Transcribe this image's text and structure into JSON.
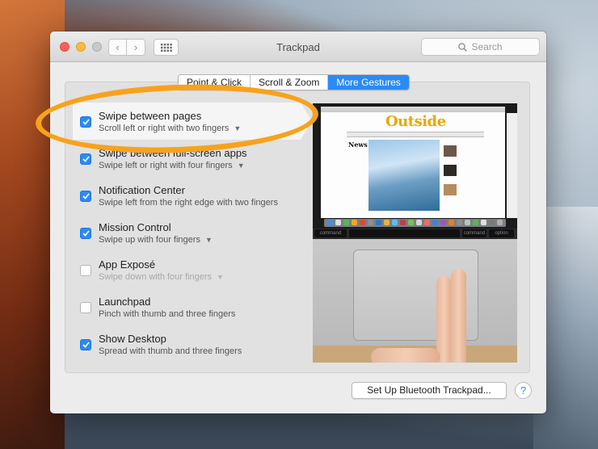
{
  "window": {
    "title": "Trackpad"
  },
  "search": {
    "placeholder": "Search"
  },
  "tabs": [
    {
      "label": "Point & Click",
      "active": false
    },
    {
      "label": "Scroll & Zoom",
      "active": false
    },
    {
      "label": "More Gestures",
      "active": true
    }
  ],
  "gestures": [
    {
      "title": "Swipe between pages",
      "subtitle": "Scroll left or right with two fingers",
      "checked": true,
      "has_dropdown": true,
      "disabled": false,
      "selected": true
    },
    {
      "title": "Swipe between full-screen apps",
      "subtitle": "Swipe left or right with four fingers",
      "checked": true,
      "has_dropdown": true,
      "disabled": false,
      "selected": false
    },
    {
      "title": "Notification Center",
      "subtitle": "Swipe left from the right edge with two fingers",
      "checked": true,
      "has_dropdown": false,
      "disabled": false,
      "selected": false
    },
    {
      "title": "Mission Control",
      "subtitle": "Swipe up with four fingers",
      "checked": true,
      "has_dropdown": true,
      "disabled": false,
      "selected": false
    },
    {
      "title": "App Exposé",
      "subtitle": "Swipe down with four fingers",
      "checked": false,
      "has_dropdown": true,
      "disabled": true,
      "selected": false
    },
    {
      "title": "Launchpad",
      "subtitle": "Pinch with thumb and three fingers",
      "checked": false,
      "has_dropdown": false,
      "disabled": false,
      "selected": false
    },
    {
      "title": "Show Desktop",
      "subtitle": "Spread with thumb and three fingers",
      "checked": true,
      "has_dropdown": false,
      "disabled": false,
      "selected": false
    }
  ],
  "preview": {
    "site_logo": "Outside",
    "section_label": "News",
    "keys": {
      "left": "command",
      "right_cmd": "command",
      "option": "option"
    }
  },
  "bottom": {
    "setup_label": "Set Up Bluetooth Trackpad...",
    "help_label": "?"
  },
  "colors": {
    "accent": "#2a8bf7",
    "highlight": "#f8a21c"
  }
}
